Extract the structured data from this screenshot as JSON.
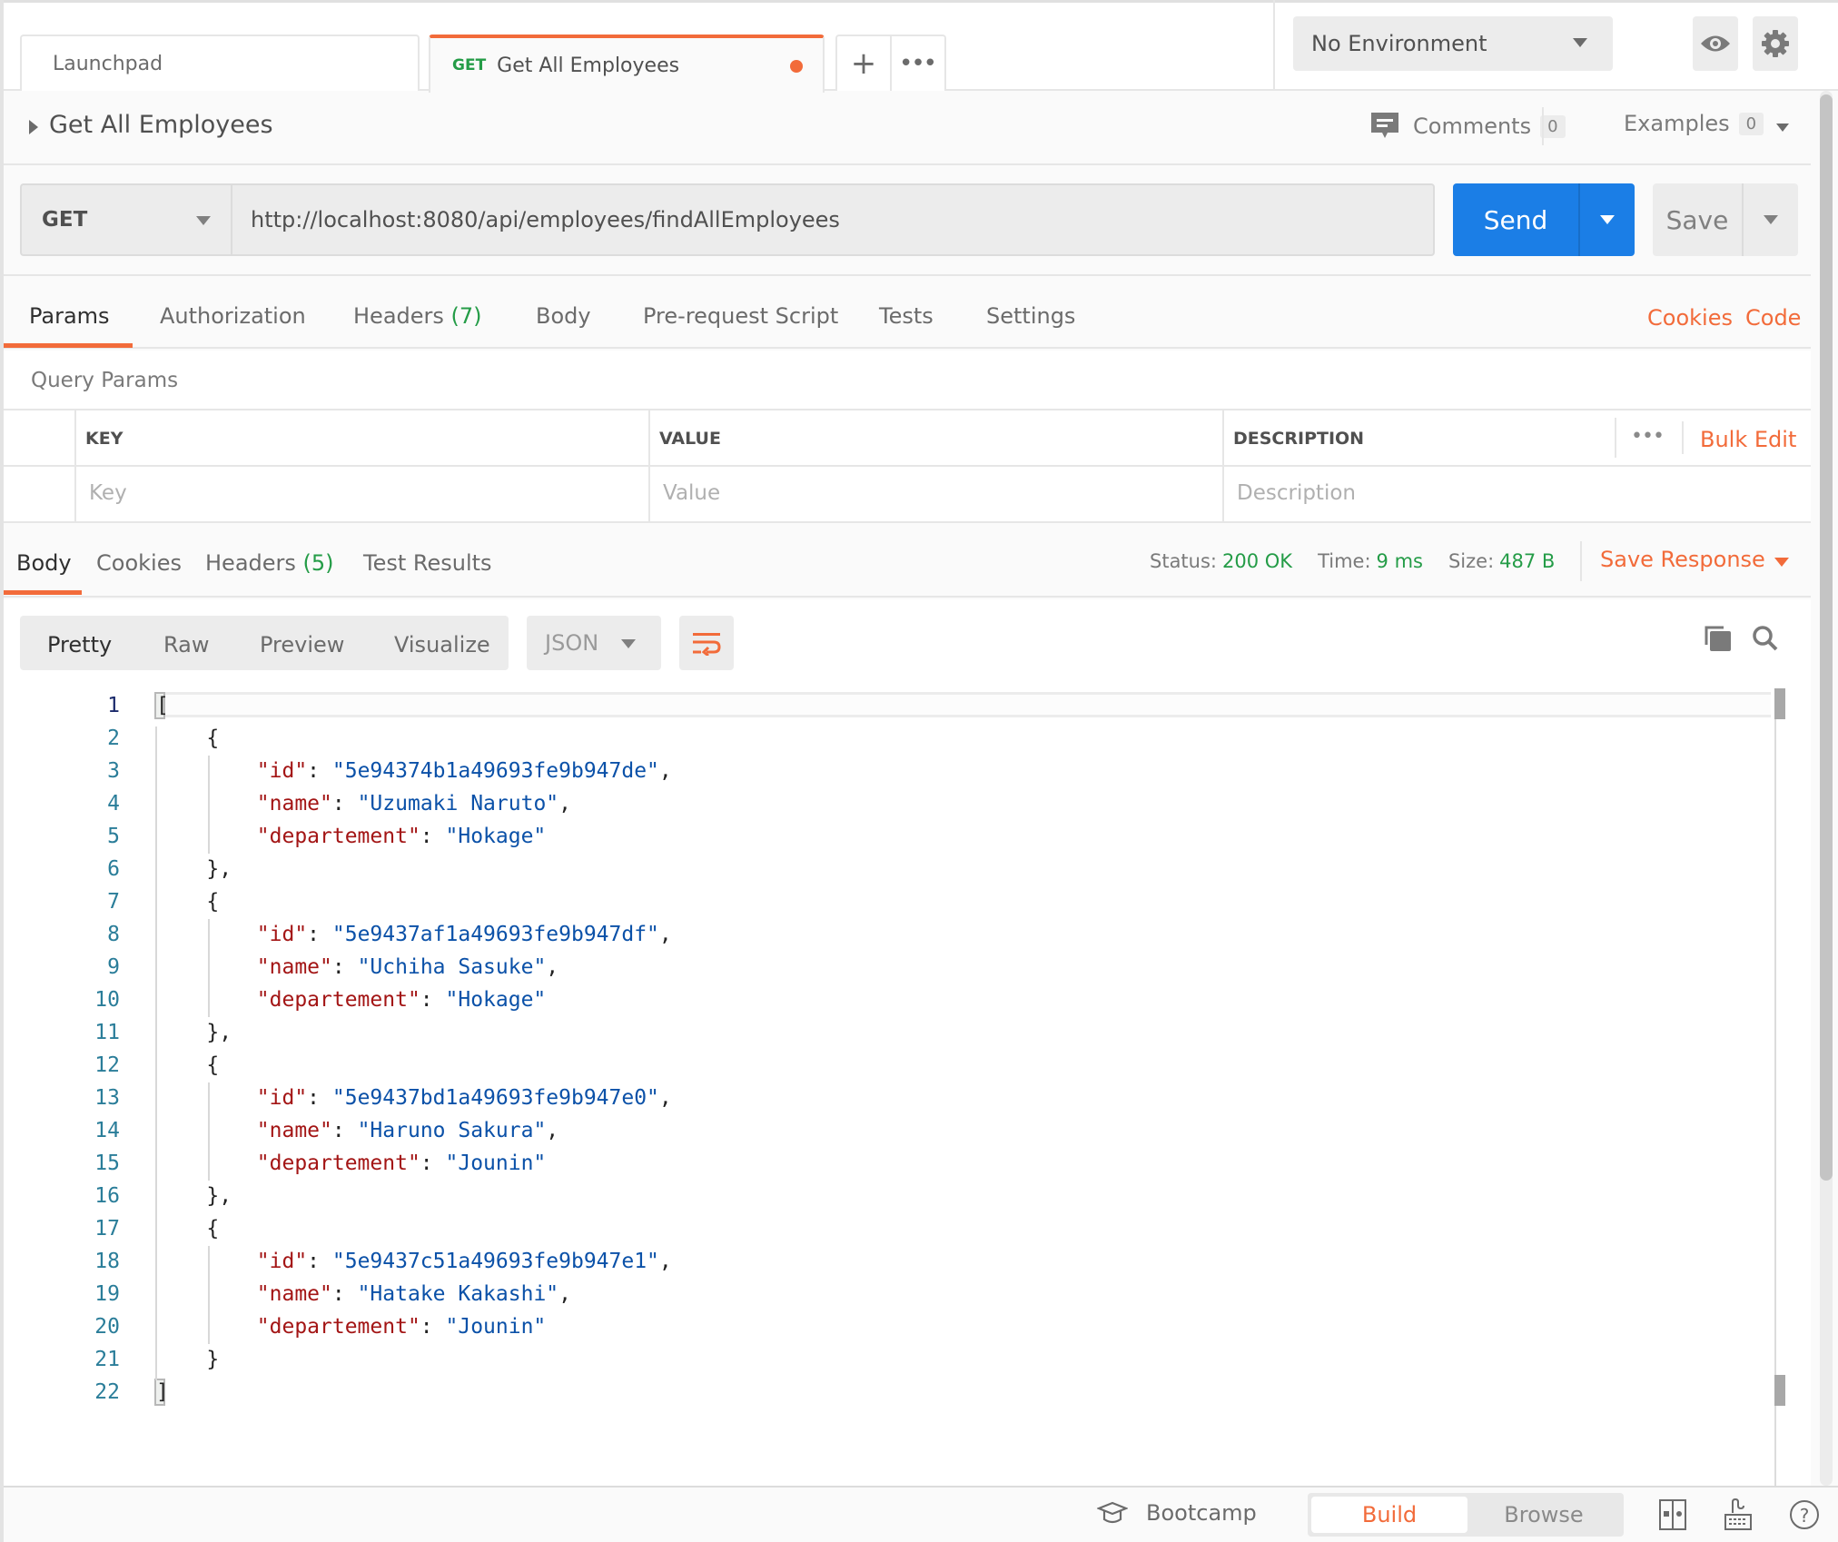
{
  "tabs": [
    {
      "label": "Launchpad"
    },
    {
      "method": "GET",
      "label": "Get All Employees",
      "unsaved": true
    }
  ],
  "tab_actions": {
    "new_tab": "+",
    "more": "•••"
  },
  "environment": {
    "selected": "No Environment"
  },
  "request": {
    "title": "Get All Employees",
    "comments_label": "Comments",
    "comments_count": "0",
    "examples_label": "Examples",
    "examples_count": "0",
    "method": "GET",
    "url": "http://localhost:8080/api/employees/findAllEmployees",
    "send_label": "Send",
    "save_label": "Save"
  },
  "request_tabs": {
    "items": [
      "Params",
      "Authorization",
      "Headers",
      "Body",
      "Pre-request Script",
      "Tests",
      "Settings"
    ],
    "headers_count": "(7)",
    "active": "Params",
    "cookies_link": "Cookies",
    "code_link": "Code"
  },
  "query_params": {
    "title": "Query Params",
    "columns": [
      "KEY",
      "VALUE",
      "DESCRIPTION"
    ],
    "placeholders": {
      "key": "Key",
      "value": "Value",
      "description": "Description"
    },
    "more": "•••",
    "bulk_edit": "Bulk Edit"
  },
  "response": {
    "tabs": [
      "Body",
      "Cookies",
      "Headers",
      "Test Results"
    ],
    "headers_count": "(5)",
    "active_tab": "Body",
    "status_label": "Status:",
    "status_value": "200 OK",
    "time_label": "Time:",
    "time_value": "9 ms",
    "size_label": "Size:",
    "size_value": "487 B",
    "save_response": "Save Response",
    "views": [
      "Pretty",
      "Raw",
      "Preview",
      "Visualize"
    ],
    "active_view": "Pretty",
    "format": "JSON",
    "employees": [
      {
        "id": "5e94374b1a49693fe9b947de",
        "name": "Uzumaki Naruto",
        "departement": "Hokage"
      },
      {
        "id": "5e9437af1a49693fe9b947df",
        "name": "Uchiha Sasuke",
        "departement": "Hokage"
      },
      {
        "id": "5e9437bd1a49693fe9b947e0",
        "name": "Haruno Sakura",
        "departement": "Jounin"
      },
      {
        "id": "5e9437c51a49693fe9b947e1",
        "name": "Hatake Kakashi",
        "departement": "Jounin"
      }
    ],
    "line_count": 22
  },
  "statusbar": {
    "bootcamp": "Bootcamp",
    "build": "Build",
    "browse": "Browse",
    "active_mode": "Build"
  },
  "colors": {
    "accent": "#f26b3a",
    "send": "#1b7ee6",
    "success": "#249c47",
    "json_key": "#a31515",
    "json_string": "#0b51a8"
  }
}
